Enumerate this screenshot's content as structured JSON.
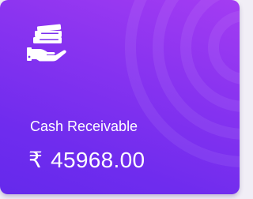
{
  "card": {
    "icon": "money-in-hand-icon",
    "label": "Cash Receivable",
    "currency_symbol": "₹",
    "amount": "45968.00",
    "colors": {
      "gradient_light": "#a43cf2",
      "gradient_dark": "#6529ec",
      "text": "#ffffff"
    }
  }
}
